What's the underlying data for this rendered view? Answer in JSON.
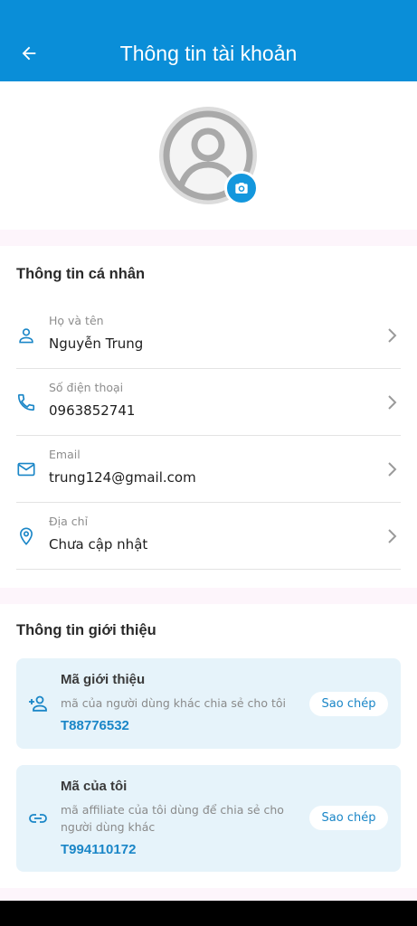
{
  "header": {
    "title": "Thông tin tài khoản"
  },
  "personal": {
    "title": "Thông tin cá nhân",
    "rows": [
      {
        "label": "Họ và tên",
        "value": "Nguyễn Trung",
        "icon": "person-icon"
      },
      {
        "label": "Số điện thoại",
        "value": "0963852741",
        "icon": "phone-icon"
      },
      {
        "label": "Email",
        "value": "trung124@gmail.com",
        "icon": "mail-icon"
      },
      {
        "label": "Địa chỉ",
        "value": "Chưa cập nhật",
        "icon": "location-icon"
      }
    ]
  },
  "intro": {
    "title": "Thông tin giới thiệu",
    "referral": {
      "title": "Mã giới thiệu",
      "desc": "mã của người dùng khác chia sẻ cho tôi",
      "code": "T88776532",
      "copy_label": "Sao chép"
    },
    "mine": {
      "title": "Mã của tôi",
      "desc": "mã affiliate của tôi dùng để chia sẻ cho người dùng khác",
      "code": "T994110172",
      "copy_label": "Sao chép"
    }
  },
  "colors": {
    "primary": "#0a8ed8",
    "accent_text": "#1a86c7",
    "code_box_bg": "#e6f3fa"
  }
}
